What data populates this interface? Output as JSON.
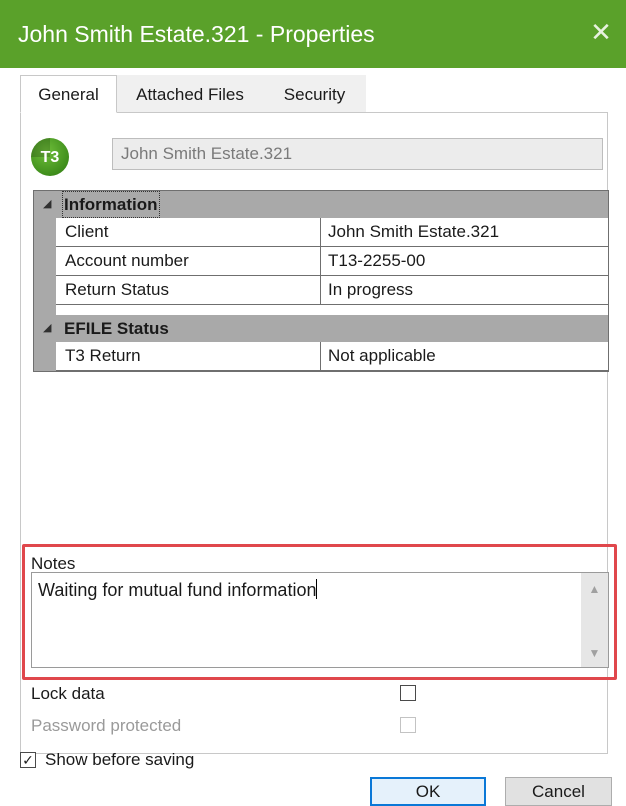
{
  "window": {
    "title": "John Smith Estate.321 - Properties",
    "close_glyph": "✕",
    "accent_color": "#5aa12a",
    "close_icon": "close-icon"
  },
  "tabs": [
    {
      "label": "General",
      "active": true
    },
    {
      "label": "Attached Files",
      "active": false
    },
    {
      "label": "Security",
      "active": false
    }
  ],
  "header": {
    "avatar_text": "T3",
    "name_value": "John Smith Estate.321"
  },
  "grid": {
    "groups": [
      {
        "label": "Information",
        "rows": [
          {
            "key": "Client",
            "value": "John Smith Estate.321"
          },
          {
            "key": "Account number",
            "value": "T13-2255-00"
          },
          {
            "key": "Return Status",
            "value": "In progress"
          }
        ]
      },
      {
        "label": "EFILE Status",
        "rows": [
          {
            "key": "T3 Return",
            "value": "Not applicable"
          }
        ]
      }
    ]
  },
  "notes": {
    "label": "Notes",
    "value": "Waiting for mutual fund information",
    "highlight_color": "#e0474c"
  },
  "options": {
    "lock_data_label": "Lock data",
    "lock_data_checked": false,
    "password_label": "Password protected",
    "password_checked": false
  },
  "footer": {
    "show_before_saving_label": "Show before saving",
    "show_before_saving_checked": true,
    "check_glyph": "✓",
    "ok_label": "OK",
    "cancel_label": "Cancel"
  }
}
